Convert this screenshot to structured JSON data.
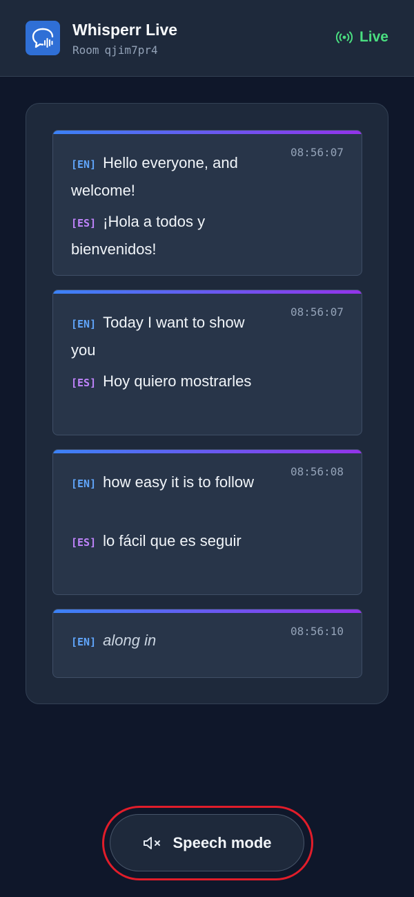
{
  "header": {
    "app_title": "Whisperr Live",
    "room_label": "Room",
    "room_code": "qjim7pr4",
    "status": "Live",
    "logo_icon": "chat-bubble-audio-icon",
    "status_icon": "broadcast-icon",
    "accent_color": "#2f6fd6",
    "status_color": "#4ade80"
  },
  "messages": [
    {
      "time": "08:56:07",
      "lines": [
        {
          "lang": "[EN]",
          "text": "Hello everyone, and welcome!"
        },
        {
          "lang": "[ES]",
          "text": "¡Hola a todos y bienvenidos!"
        }
      ]
    },
    {
      "time": "08:56:07",
      "lines": [
        {
          "lang": "[EN]",
          "text": "Today I want to show you"
        },
        {
          "lang": "[ES]",
          "text": "Hoy quiero mostrarles"
        }
      ]
    },
    {
      "time": "08:56:08",
      "lines": [
        {
          "lang": "[EN]",
          "text": "how easy it is to follow"
        },
        {
          "lang": "[ES]",
          "text": "lo fácil que es seguir"
        }
      ]
    },
    {
      "time": "08:56:10",
      "lines": [
        {
          "lang": "[EN]",
          "text": "along in",
          "interim": true
        }
      ]
    }
  ],
  "speech_button": {
    "label": "Speech mode",
    "icon": "speaker-muted-icon"
  }
}
